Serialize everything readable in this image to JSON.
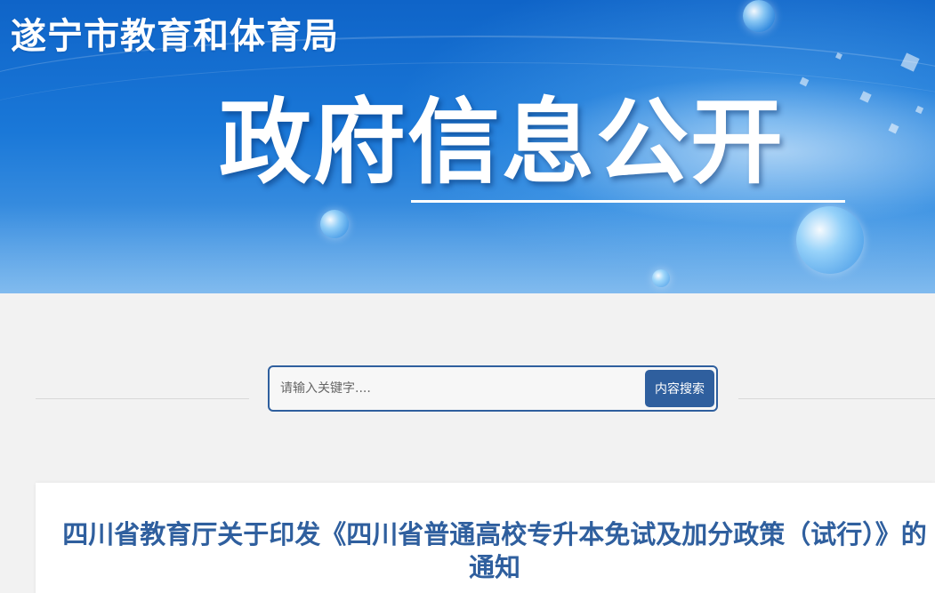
{
  "header": {
    "org_name": "遂宁市教育和体育局",
    "hero_title": "政府信息公开"
  },
  "search": {
    "placeholder": "请输入关键字....",
    "value": "",
    "button_label": "内容搜索"
  },
  "article": {
    "title": "四川省教育厅关于印发《四川省普通高校专升本免试及加分政策（试行）》的通知"
  },
  "colors": {
    "banner_blue": "#1a78d8",
    "accent_navy": "#2f5f9e",
    "page_bg": "#f2f2f2"
  }
}
